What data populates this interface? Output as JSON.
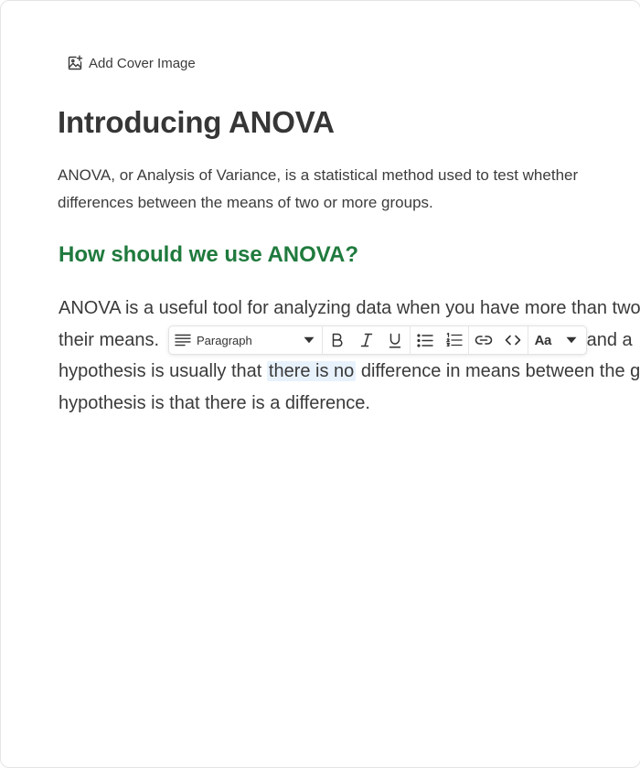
{
  "cover": {
    "label": "Add Cover Image",
    "icon": "add-image-icon"
  },
  "document": {
    "title": "Introducing ANOVA",
    "intro_lines": [
      "ANOVA, or Analysis of Variance, is a statistical method used to test whether",
      "differences between the means of two or more groups."
    ],
    "heading": "How should we use ANOVA?",
    "body": {
      "line1": "ANOVA is a useful tool for analyzing data when you have more than two groups and want to compare",
      "line2_start": "their means.",
      "line2_end": " and a",
      "line3_start": "hypothesis is usually that ",
      "line3_selected": "there is no",
      "line3_end": " difference in means between the groups",
      "line4": "hypothesis is that there is a difference."
    }
  },
  "toolbar": {
    "block_type": "Paragraph",
    "font_size_label": "Aa",
    "icons": [
      "paragraph-icon",
      "chevron-down-icon",
      "bold-icon",
      "italic-icon",
      "underline-icon",
      "bullet-list-icon",
      "numbered-list-icon",
      "link-icon",
      "code-icon",
      "chevron-down-icon"
    ]
  },
  "colors": {
    "heading_green": "#1f7a3d",
    "selection": "#e8f2fd"
  }
}
